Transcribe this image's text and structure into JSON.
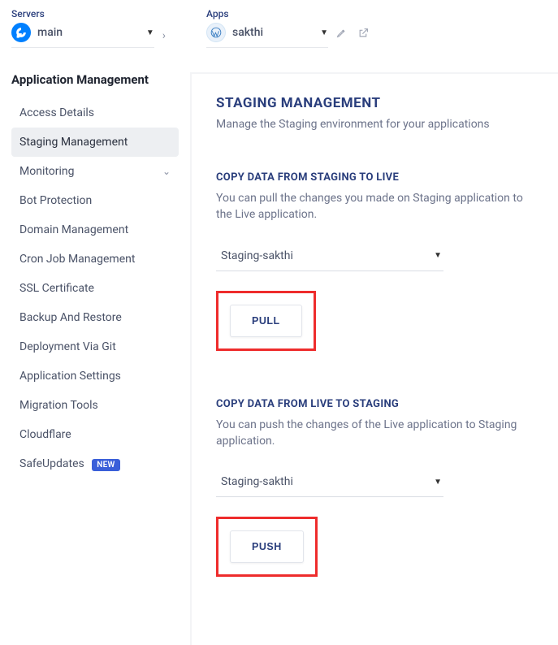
{
  "breadcrumb": {
    "servers_label": "Servers",
    "server_name": "main",
    "apps_label": "Apps",
    "app_name": "sakthi"
  },
  "sidebar": {
    "title": "Application Management",
    "items": [
      {
        "label": "Access Details"
      },
      {
        "label": "Staging Management"
      },
      {
        "label": "Monitoring"
      },
      {
        "label": "Bot Protection"
      },
      {
        "label": "Domain Management"
      },
      {
        "label": "Cron Job Management"
      },
      {
        "label": "SSL Certificate"
      },
      {
        "label": "Backup And Restore"
      },
      {
        "label": "Deployment Via Git"
      },
      {
        "label": "Application Settings"
      },
      {
        "label": "Migration Tools"
      },
      {
        "label": "Cloudflare"
      },
      {
        "label": "SafeUpdates"
      }
    ],
    "new_badge": "NEW"
  },
  "main": {
    "title": "STAGING MANAGEMENT",
    "subtitle": "Manage the Staging environment for your applications",
    "stg_to_live": {
      "heading": "COPY DATA FROM STAGING TO LIVE",
      "desc": "You can pull the changes you made on Staging application to the Live application.",
      "select_value": "Staging-sakthi",
      "button": "PULL"
    },
    "live_to_stg": {
      "heading": "COPY DATA FROM LIVE TO STAGING",
      "desc": "You can push the changes of the Live application to Staging application.",
      "select_value": "Staging-sakthi",
      "button": "PUSH"
    }
  }
}
